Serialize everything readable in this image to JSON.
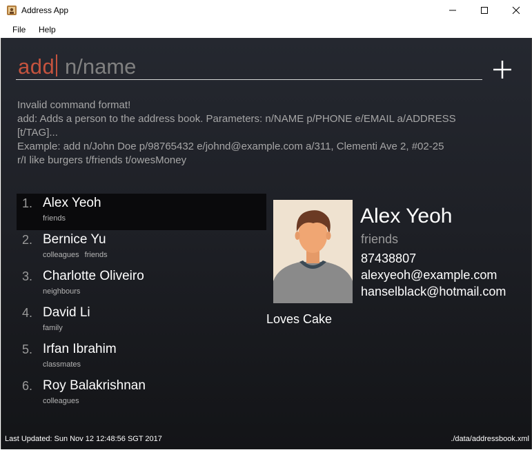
{
  "window": {
    "title": "Address App"
  },
  "menu": {
    "items": [
      "File",
      "Help"
    ]
  },
  "command": {
    "typed": "add",
    "placeholder": "n/name"
  },
  "result": {
    "lines": [
      "Invalid command format!",
      "add: Adds a person to the address book. Parameters: n/NAME p/PHONE e/EMAIL a/ADDRESS",
      "[t/TAG]...",
      "Example: add n/John Doe p/98765432 e/johnd@example.com a/311, Clementi Ave 2, #02-25",
      "r/I like burgers t/friends t/owesMoney"
    ]
  },
  "persons": [
    {
      "index": "1.",
      "name": "Alex Yeoh",
      "tags": [
        "friends"
      ],
      "selected": true
    },
    {
      "index": "2.",
      "name": "Bernice Yu",
      "tags": [
        "colleagues",
        "friends"
      ]
    },
    {
      "index": "3.",
      "name": "Charlotte Oliveiro",
      "tags": [
        "neighbours"
      ]
    },
    {
      "index": "4.",
      "name": "David Li",
      "tags": [
        "family"
      ]
    },
    {
      "index": "5.",
      "name": "Irfan Ibrahim",
      "tags": [
        "classmates"
      ]
    },
    {
      "index": "6.",
      "name": "Roy Balakrishnan",
      "tags": [
        "colleagues"
      ]
    }
  ],
  "detail": {
    "name": "Alex Yeoh",
    "tag": "friends",
    "phone": "87438807",
    "email": "alexyeoh@example.com",
    "email2": "hanselblack@hotmail.com",
    "remark": "Loves Cake",
    "photo_icon": "person-avatar-icon"
  },
  "status": {
    "last_updated": "Last Updated: Sun Nov 12 12:48:56 SGT 2017",
    "file_path": "./data/addressbook.xml"
  },
  "colors": {
    "accent": "#c5533e",
    "background": "#1e2026"
  }
}
